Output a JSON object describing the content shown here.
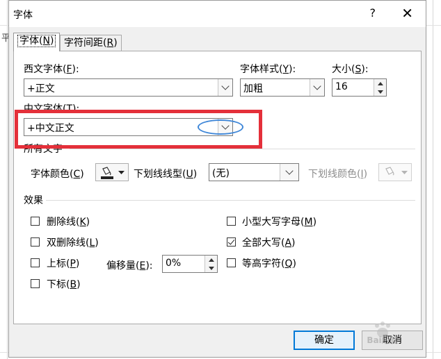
{
  "background": {
    "glyph": "平"
  },
  "dialog": {
    "title": "字体",
    "help_label": "?",
    "close_label": "✕"
  },
  "tabs": [
    {
      "label": "字体(",
      "key": "N",
      "tail": ")",
      "active": true
    },
    {
      "label": "字符间距(",
      "key": "R",
      "tail": ")",
      "active": false
    }
  ],
  "latin_font": {
    "label": "西文字体(",
    "key": "F",
    "tail": "):",
    "value": "+正文"
  },
  "font_style": {
    "label": "字体样式(",
    "key": "Y",
    "tail": "):",
    "value": "加粗"
  },
  "font_size": {
    "label": "大小(",
    "key": "S",
    "tail": "):",
    "value": "16"
  },
  "asian_font": {
    "label": "中文字体(",
    "key": "T",
    "tail": "):",
    "value": "+中文正文"
  },
  "all_text_heading": "所有文字",
  "font_color": {
    "label": "字体颜色(",
    "key": "C",
    "tail": ")"
  },
  "underline_style": {
    "label": "下划线线型(",
    "key": "U",
    "tail": ")",
    "value": "(无)"
  },
  "underline_color": {
    "label": "下划线颜色(",
    "key": "I",
    "tail": ")"
  },
  "effects_heading": "效果",
  "effects": {
    "strikethrough": {
      "label": "删除线(",
      "key": "K",
      "tail": ")",
      "checked": false
    },
    "double_strikethrough": {
      "label": "双删除线(",
      "key": "L",
      "tail": ")",
      "checked": false
    },
    "superscript": {
      "label": "上标(",
      "key": "P",
      "tail": ")",
      "checked": false
    },
    "subscript": {
      "label": "下标(",
      "key": "B",
      "tail": ")",
      "checked": false
    },
    "small_caps": {
      "label": "小型大写字母(",
      "key": "M",
      "tail": ")",
      "checked": false
    },
    "all_caps": {
      "label": "全部大写(",
      "key": "A",
      "tail": ")",
      "checked": true
    },
    "equalize_height": {
      "label": "等高字符(",
      "key": "Q",
      "tail": ")",
      "checked": false
    }
  },
  "offset": {
    "label": "偏移量(",
    "key": "E",
    "tail": "):",
    "value": "0%"
  },
  "buttons": {
    "ok": "确定",
    "cancel": "取消"
  },
  "annotation_colors": {
    "rect": "#e4303a",
    "ellipse": "#3f87d8"
  },
  "watermark_text": "Bai经验"
}
